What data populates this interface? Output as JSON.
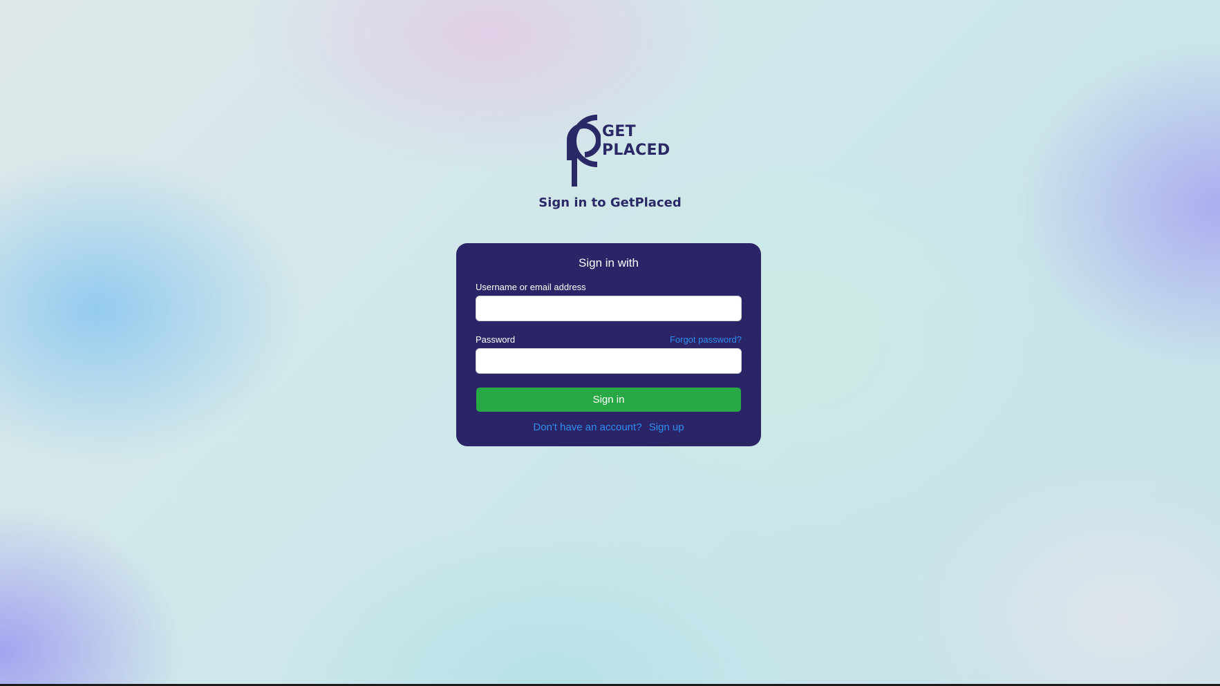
{
  "brand": {
    "logo_line1": "GET",
    "logo_line2": "PLACED",
    "color": "#2b2866"
  },
  "page_title": "Sign in to GetPlaced",
  "card": {
    "heading": "Sign in with",
    "username_label": "Username or email address",
    "username_value": "",
    "password_label": "Password",
    "password_value": "",
    "forgot_password": "Forgot password?",
    "signin_button": "Sign in",
    "no_account_text": "Don't have an account?",
    "signup_link": "Sign up",
    "card_color": "#2a2566",
    "button_color": "#28a745",
    "link_color": "#2f8ef0"
  }
}
